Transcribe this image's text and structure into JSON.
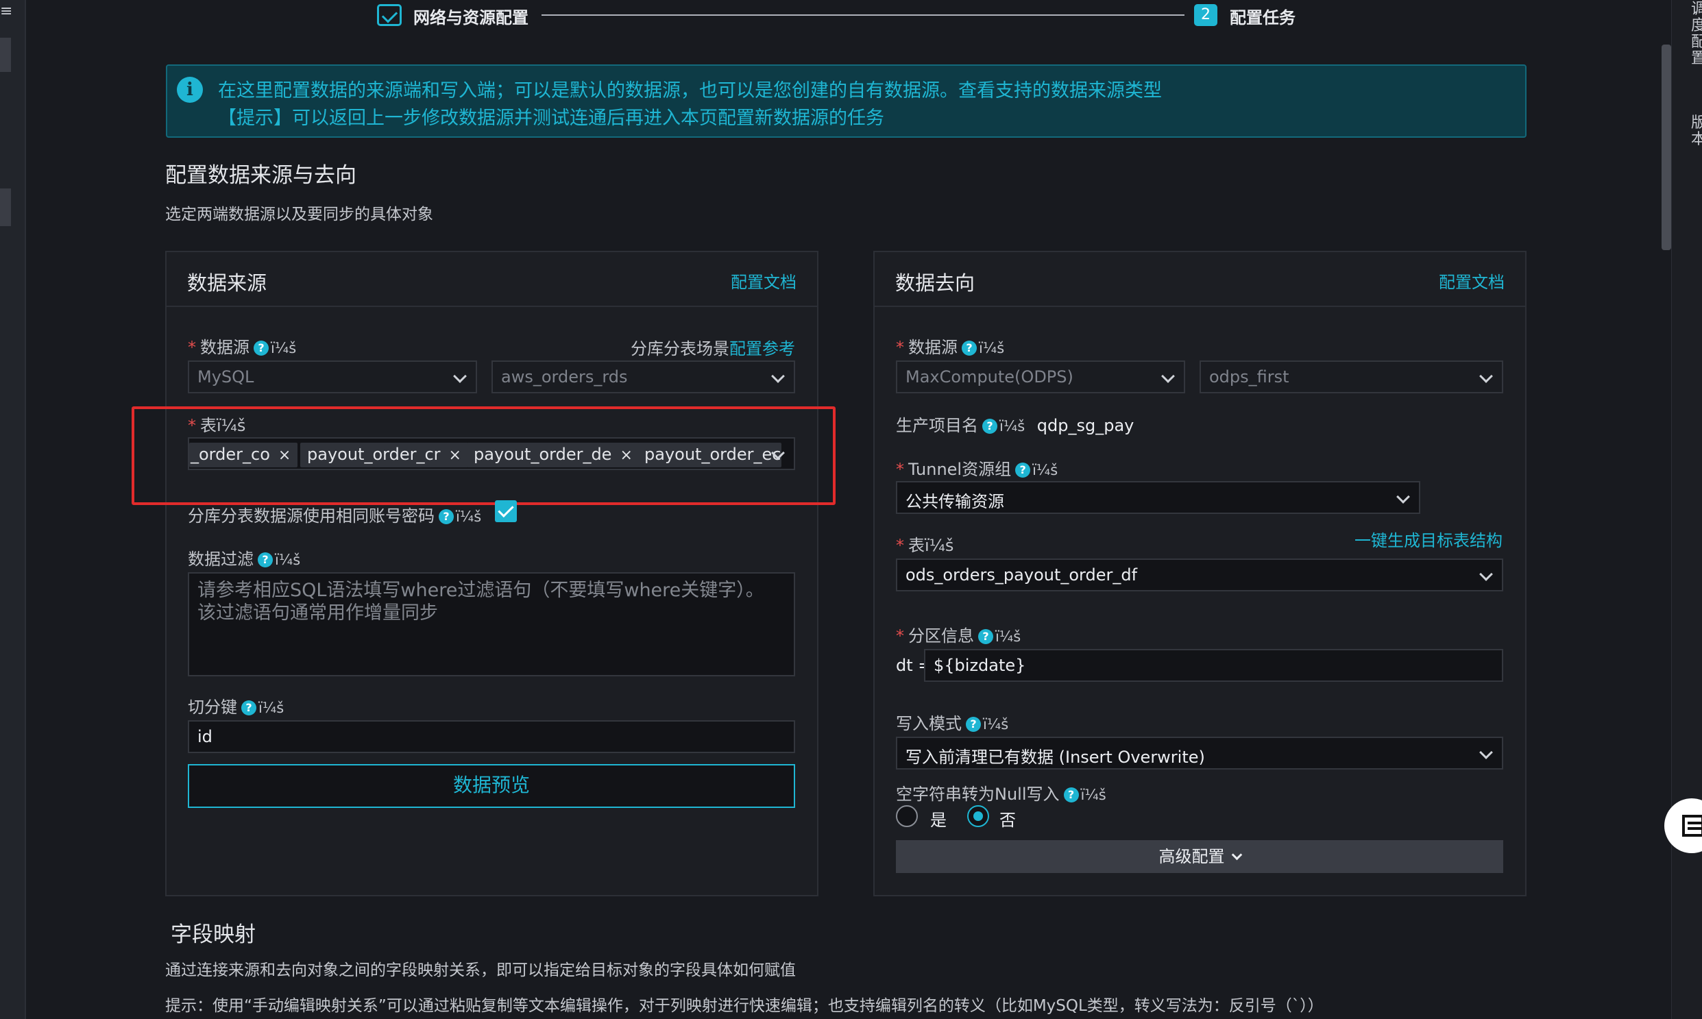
{
  "steps": [
    {
      "label": "网络与资源配置",
      "state": "done"
    },
    {
      "number": "2",
      "label": "配置任务",
      "state": "current"
    }
  ],
  "info": {
    "line1": "在这里配置数据的来源端和写入端；可以是默认的数据源，也可以是您创建的自有数据源。查看支持的数据来源类型",
    "line2": "【提示】可以返回上一步修改数据源并测试连通后再进入本页配置新数据源的任务"
  },
  "config_section": {
    "title": "配置数据来源与去向",
    "desc": "选定两端数据源以及要同步的具体对象"
  },
  "source": {
    "title": "数据来源",
    "doc_link": "配置文档",
    "datasource_label": "数据源",
    "garble": "ï¼š",
    "shard_hint": "分库分表场景",
    "shard_link": "配置参考",
    "datasource_type": "MySQL",
    "datasource_name": "aws_orders_rds",
    "table_label": "表ï¼š",
    "tables": [
      "_order_co",
      "payout_order_cr",
      "payout_order_de",
      "payout_order_ec"
    ],
    "tag_close": "×",
    "same_account_label": "分库分表数据源使用相同账号密码",
    "same_account_checked": true,
    "filter_label": "数据过滤",
    "filter_placeholder_1": "请参考相应SQL语法填写where过滤语句（不要填写where关键字）。",
    "filter_placeholder_2": "该过滤语句通常用作增量同步",
    "split_key_label": "切分键",
    "split_key_value": "id",
    "preview_button": "数据预览"
  },
  "target": {
    "title": "数据去向",
    "doc_link": "配置文档",
    "datasource_label": "数据源",
    "garble": "ï¼š",
    "datasource_type": "MaxCompute(ODPS)",
    "datasource_name": "odps_first",
    "project_label": "生产项目名",
    "project_value": "qdp_sg_pay",
    "tunnel_label": "Tunnel资源组",
    "tunnel_value": "公共传输资源",
    "table_label": "表ï¼š",
    "generate_link": "一键生成目标表结构",
    "table_value": "ods_orders_payout_order_df",
    "partition_label": "分区信息",
    "partition_key": "dt =",
    "partition_value": "${bizdate}",
    "write_mode_label": "写入模式",
    "write_mode_value": "写入前清理已有数据 (Insert Overwrite)",
    "null_label": "空字符串转为Null写入",
    "radio_yes": "是",
    "radio_no": "否",
    "null_selected": "否",
    "advanced_button": "高级配置"
  },
  "mapping": {
    "title": "字段映射",
    "desc": "通过连接来源和去向对象之间的字段映射关系，即可以指定给目标对象的字段具体如何赋值",
    "tip": "提示：使用“手动编辑映射关系”可以通过粘贴复制等文本编辑操作，对于列映射进行快速编辑；也支持编辑列名的转义（比如MySQL类型，转义写法为：反引号（`））"
  },
  "right_panel": {
    "text1": "调度配置",
    "text2": "版本"
  },
  "colors": {
    "accent": "#1fb6d3",
    "background": "#181a1f",
    "panel": "#1c1e23",
    "highlight_box": "#e12b2b",
    "required": "#e34d4d"
  },
  "icons": [
    "menu-icon",
    "check-icon",
    "info-icon",
    "help-icon",
    "chevron-down-icon",
    "close-icon",
    "checkbox-icon",
    "grid-icon"
  ]
}
